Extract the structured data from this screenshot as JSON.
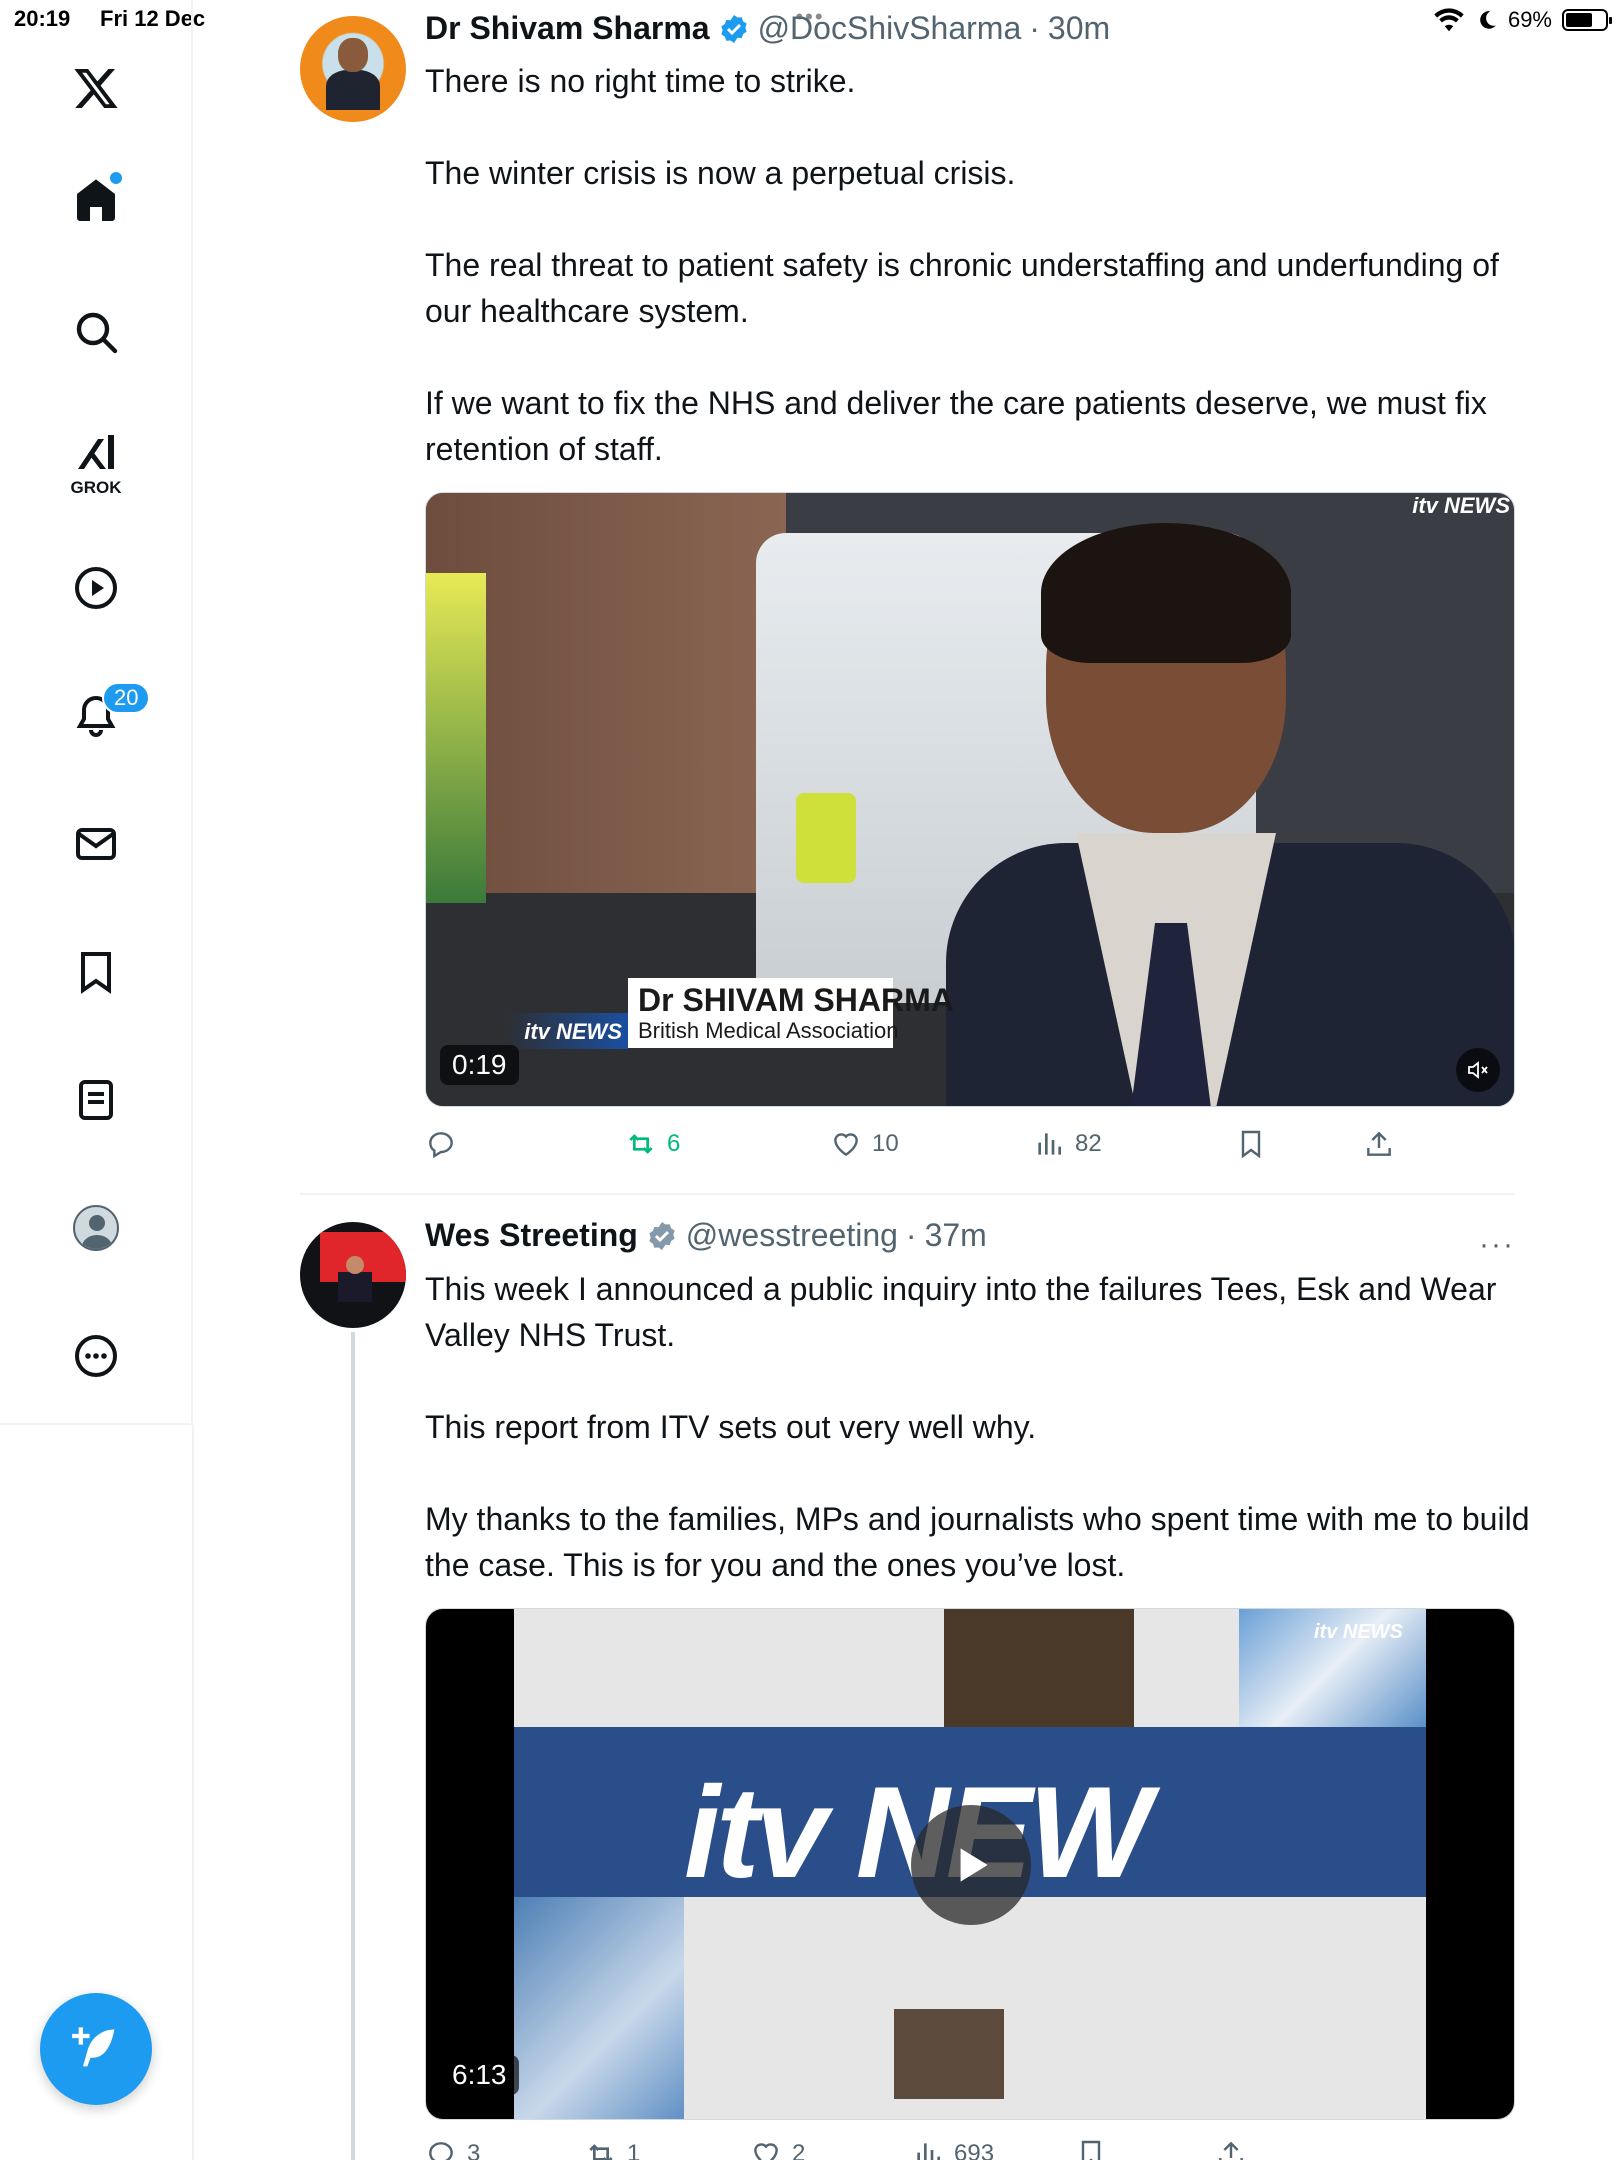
{
  "status_bar": {
    "time": "20:19",
    "date": "Fri 12 Dec",
    "battery": "69%",
    "battery_level": 0.69
  },
  "sidebar": {
    "notifications_badge": "20",
    "grok_label": "GROK",
    "items": [
      {
        "name": "x-logo-icon"
      },
      {
        "name": "home-icon"
      },
      {
        "name": "search-icon"
      },
      {
        "name": "grok-icon"
      },
      {
        "name": "video-icon"
      },
      {
        "name": "notifications-icon"
      },
      {
        "name": "messages-icon"
      },
      {
        "name": "bookmarks-icon"
      },
      {
        "name": "lists-icon"
      },
      {
        "name": "profile-icon"
      },
      {
        "name": "more-icon"
      }
    ]
  },
  "tweets": [
    {
      "display_name": "Dr Shivam Sharma",
      "handle": "@DocShivSharma",
      "sep": "·",
      "time": "30m",
      "paragraphs": [
        "There is no right time to strike.",
        "The winter crisis is now a perpetual crisis.",
        "The real threat to patient safety is chronic understaffing and underfunding of our healthcare system.",
        "If we want to fix the NHS and deliver the care patients deserve, we must fix retention of staff."
      ],
      "media": {
        "duration": "0:19",
        "lower_third_name": "Dr SHIVAM SHARMA",
        "lower_third_org": "British Medical Association",
        "channel_logo": "itv NEWS",
        "corner_logo": "itv NEWS"
      },
      "actions": {
        "replies": "",
        "reposts": "6",
        "likes": "10",
        "views": "82"
      }
    },
    {
      "display_name": "Wes Streeting",
      "handle": "@wesstreeting",
      "sep": "·",
      "time": "37m",
      "more": "···",
      "paragraphs": [
        "This week I announced a public inquiry into the failures Tees, Esk and Wear Valley NHS Trust.",
        "This report from ITV sets out very well why.",
        "My thanks to the families, MPs and journalists who spent time with me to build the case. This is for you and the ones you’ve lost."
      ],
      "media": {
        "duration": "6:13",
        "big_text": "itv NEW",
        "corner_logo": "itv NEWS"
      },
      "actions": {
        "replies": "3",
        "reposts": "1",
        "likes": "2",
        "views": "693"
      }
    }
  ],
  "colors": {
    "accent": "#1d9bf0",
    "text": "#0f1419",
    "muted": "#536471",
    "repost_active": "#00ba7c"
  }
}
